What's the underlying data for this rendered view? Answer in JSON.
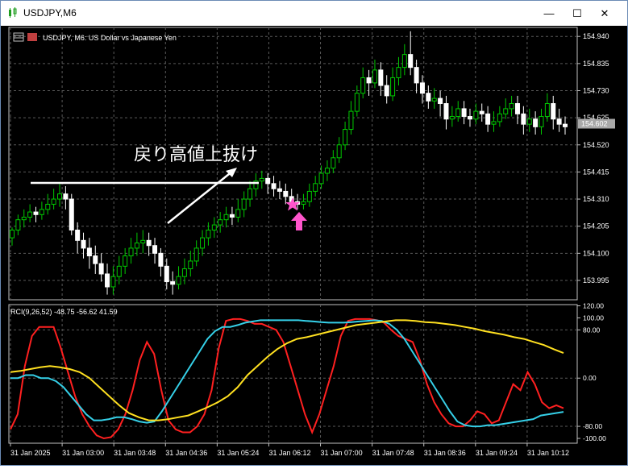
{
  "window": {
    "title": "USDJPY,M6",
    "buttons": {
      "minimize": "—",
      "maximize": "☐",
      "close": "✕"
    }
  },
  "chart_header": {
    "symbol_line": "USDJPY, M6:  US Dollar vs Japanese Yen",
    "indicator_line": "RCI(9,26,52) -48.75 -56.62 41.59"
  },
  "annotation": {
    "text": "戻り高値上抜け",
    "star_color": "#ff55cc",
    "arrow_color": "#ff55cc"
  },
  "colors": {
    "background": "#000000",
    "grid": "#5a5a5a",
    "bull": "#00c800",
    "bear": "#ffffff",
    "rci_fast": "#ff2020",
    "rci_mid": "#35d0e8",
    "rci_slow": "#ffe020",
    "axis_text": "#ffffff",
    "current_price_tag": "#a9a9a9"
  },
  "chart_data": {
    "type": "candlestick",
    "price_axis": {
      "ticks": [
        "154.940",
        "154.835",
        "154.730",
        "154.625",
        "154.520",
        "154.415",
        "154.310",
        "154.205",
        "154.100",
        "153.995"
      ],
      "tick_values": [
        154.94,
        154.835,
        154.73,
        154.625,
        154.52,
        154.415,
        154.31,
        154.205,
        154.1,
        153.995
      ],
      "range": [
        153.92,
        154.975
      ],
      "current_price": "154.602"
    },
    "time_axis": [
      "31 Jan 2025",
      "31 Jan 03:00",
      "31 Jan 03:48",
      "31 Jan 04:36",
      "31 Jan 05:24",
      "31 Jan 06:12",
      "31 Jan 07:00",
      "31 Jan 07:48",
      "31 Jan 08:36",
      "31 Jan 09:24",
      "31 Jan 10:12"
    ],
    "candles": [
      [
        154.16,
        154.19,
        154.13,
        154.2
      ],
      [
        154.19,
        154.23,
        154.17,
        154.25
      ],
      [
        154.23,
        154.24,
        154.2,
        154.27
      ],
      [
        154.24,
        154.26,
        154.22,
        154.29
      ],
      [
        154.26,
        154.25,
        154.22,
        154.28
      ],
      [
        154.25,
        154.27,
        154.23,
        154.3
      ],
      [
        154.27,
        154.29,
        154.25,
        154.33
      ],
      [
        154.29,
        154.31,
        154.27,
        154.35
      ],
      [
        154.31,
        154.33,
        154.28,
        154.37
      ],
      [
        154.33,
        154.31,
        154.27,
        154.36
      ],
      [
        154.31,
        154.19,
        154.17,
        154.33
      ],
      [
        154.19,
        154.15,
        154.1,
        154.22
      ],
      [
        154.15,
        154.12,
        154.08,
        154.18
      ],
      [
        154.12,
        154.09,
        154.04,
        154.16
      ],
      [
        154.09,
        154.06,
        154.02,
        154.13
      ],
      [
        154.06,
        154.02,
        153.99,
        154.1
      ],
      [
        154.02,
        153.97,
        153.94,
        154.06
      ],
      [
        153.97,
        154.01,
        153.94,
        154.05
      ],
      [
        154.01,
        154.05,
        153.98,
        154.09
      ],
      [
        154.05,
        154.09,
        154.02,
        154.12
      ],
      [
        154.09,
        154.12,
        154.06,
        154.16
      ],
      [
        154.12,
        154.14,
        154.09,
        154.18
      ],
      [
        154.14,
        154.15,
        154.1,
        154.19
      ],
      [
        154.15,
        154.13,
        154.09,
        154.18
      ],
      [
        154.13,
        154.1,
        154.06,
        154.16
      ],
      [
        154.1,
        154.05,
        154.01,
        154.12
      ],
      [
        154.05,
        153.99,
        153.96,
        154.08
      ],
      [
        153.99,
        153.98,
        153.94,
        154.03
      ],
      [
        153.98,
        154.01,
        153.96,
        154.05
      ],
      [
        154.01,
        154.04,
        153.98,
        154.08
      ],
      [
        154.04,
        154.07,
        154.01,
        154.11
      ],
      [
        154.07,
        154.12,
        154.05,
        154.15
      ],
      [
        154.12,
        154.16,
        154.09,
        154.19
      ],
      [
        154.16,
        154.19,
        154.13,
        154.22
      ],
      [
        154.19,
        154.21,
        154.16,
        154.24
      ],
      [
        154.21,
        154.23,
        154.18,
        154.26
      ],
      [
        154.23,
        154.25,
        154.2,
        154.28
      ],
      [
        154.25,
        154.24,
        154.21,
        154.28
      ],
      [
        154.24,
        154.27,
        154.22,
        154.31
      ],
      [
        154.27,
        154.31,
        154.24,
        154.34
      ],
      [
        154.31,
        154.35,
        154.28,
        154.38
      ],
      [
        154.35,
        154.38,
        154.32,
        154.41
      ],
      [
        154.38,
        154.39,
        154.35,
        154.42
      ],
      [
        154.39,
        154.37,
        154.33,
        154.41
      ],
      [
        154.37,
        154.35,
        154.32,
        154.4
      ],
      [
        154.35,
        154.34,
        154.31,
        154.38
      ],
      [
        154.34,
        154.32,
        154.29,
        154.37
      ],
      [
        154.32,
        154.3,
        154.28,
        154.35
      ],
      [
        154.3,
        154.29,
        154.27,
        154.33
      ],
      [
        154.29,
        154.3,
        154.27,
        154.33
      ],
      [
        154.3,
        154.34,
        154.28,
        154.37
      ],
      [
        154.34,
        154.37,
        154.32,
        154.4
      ],
      [
        154.37,
        154.41,
        154.35,
        154.44
      ],
      [
        154.41,
        154.43,
        154.38,
        154.46
      ],
      [
        154.43,
        154.47,
        154.41,
        154.5
      ],
      [
        154.47,
        154.52,
        154.45,
        154.55
      ],
      [
        154.52,
        154.58,
        154.5,
        154.61
      ],
      [
        154.58,
        154.65,
        154.56,
        154.69
      ],
      [
        154.65,
        154.72,
        154.63,
        154.75
      ],
      [
        154.72,
        154.78,
        154.7,
        154.82
      ],
      [
        154.78,
        154.76,
        154.71,
        154.81
      ],
      [
        154.76,
        154.81,
        154.74,
        154.85
      ],
      [
        154.81,
        154.75,
        154.71,
        154.84
      ],
      [
        154.75,
        154.71,
        154.68,
        154.79
      ],
      [
        154.71,
        154.78,
        154.69,
        154.82
      ],
      [
        154.78,
        154.82,
        154.75,
        154.86
      ],
      [
        154.82,
        154.87,
        154.79,
        154.91
      ],
      [
        154.87,
        154.82,
        154.79,
        154.96
      ],
      [
        154.82,
        154.76,
        154.72,
        154.85
      ],
      [
        154.76,
        154.72,
        154.68,
        154.79
      ],
      [
        154.72,
        154.69,
        154.66,
        154.75
      ],
      [
        154.69,
        154.7,
        154.66,
        154.74
      ],
      [
        154.7,
        154.68,
        154.63,
        154.73
      ],
      [
        154.68,
        154.62,
        154.58,
        154.71
      ],
      [
        154.62,
        154.63,
        154.59,
        154.67
      ],
      [
        154.63,
        154.66,
        154.61,
        154.69
      ],
      [
        154.66,
        154.63,
        154.6,
        154.69
      ],
      [
        154.63,
        154.62,
        154.59,
        154.66
      ],
      [
        154.62,
        154.65,
        154.6,
        154.68
      ],
      [
        154.65,
        154.64,
        154.61,
        154.68
      ],
      [
        154.64,
        154.6,
        154.57,
        154.67
      ],
      [
        154.6,
        154.61,
        154.57,
        154.65
      ],
      [
        154.61,
        154.64,
        154.59,
        154.67
      ],
      [
        154.64,
        154.66,
        154.62,
        154.7
      ],
      [
        154.66,
        154.68,
        154.63,
        154.71
      ],
      [
        154.68,
        154.64,
        154.6,
        154.71
      ],
      [
        154.64,
        154.6,
        154.56,
        154.67
      ],
      [
        154.6,
        154.62,
        154.57,
        154.66
      ],
      [
        154.62,
        154.59,
        154.56,
        154.65
      ],
      [
        154.59,
        154.63,
        154.56,
        154.66
      ],
      [
        154.63,
        154.68,
        154.61,
        154.72
      ],
      [
        154.68,
        154.62,
        154.58,
        154.71
      ],
      [
        154.62,
        154.6,
        154.57,
        154.66
      ],
      [
        154.6,
        154.59,
        154.56,
        154.63
      ]
    ],
    "rci_axis": {
      "ticks": [
        "120.00",
        "100.00",
        "80.00",
        "0.00",
        "-80.00",
        "-100.00"
      ],
      "tick_values": [
        120,
        100,
        80,
        0,
        -80,
        -100
      ],
      "range": [
        -108,
        122
      ]
    },
    "rci_series": [
      {
        "name": "RCI 9",
        "values": [
          -85,
          -60,
          20,
          70,
          85,
          85,
          85,
          50,
          10,
          -30,
          -60,
          -80,
          -95,
          -100,
          -98,
          -85,
          -60,
          -20,
          30,
          60,
          40,
          -20,
          -70,
          -85,
          -90,
          -90,
          -80,
          -60,
          -20,
          50,
          95,
          98,
          98,
          95,
          90,
          90,
          85,
          80,
          60,
          20,
          -20,
          -60,
          -90,
          -60,
          -20,
          20,
          70,
          95,
          98,
          98,
          98,
          96,
          92,
          80,
          70,
          65,
          60,
          30,
          -10,
          -40,
          -60,
          -75,
          -80,
          -80,
          -70,
          -55,
          -60,
          -75,
          -70,
          -40,
          -10,
          -20,
          10,
          -10,
          -40,
          -50,
          -45,
          -50
        ]
      },
      {
        "name": "RCI 26",
        "values": [
          0,
          0,
          5,
          5,
          0,
          0,
          -5,
          -15,
          -30,
          -45,
          -60,
          -70,
          -70,
          -68,
          -65,
          -65,
          -68,
          -72,
          -74,
          -72,
          -55,
          -35,
          -15,
          5,
          25,
          45,
          65,
          78,
          85,
          85,
          88,
          92,
          94,
          96,
          96,
          96,
          96,
          96,
          96,
          95,
          94,
          93,
          92,
          92,
          92,
          93,
          94,
          95,
          96,
          95,
          90,
          80,
          65,
          45,
          25,
          5,
          -15,
          -35,
          -55,
          -72,
          -78,
          -80,
          -80,
          -78,
          -78,
          -76,
          -74,
          -72,
          -70,
          -68,
          -62,
          -60,
          -58,
          -56
        ]
      },
      {
        "name": "RCI 52",
        "values": [
          10,
          12,
          15,
          18,
          20,
          18,
          15,
          10,
          0,
          -15,
          -30,
          -45,
          -58,
          -65,
          -70,
          -70,
          -68,
          -65,
          -62,
          -55,
          -48,
          -40,
          -30,
          -15,
          5,
          20,
          35,
          48,
          58,
          65,
          68,
          72,
          76,
          80,
          84,
          88,
          90,
          92,
          94,
          96,
          96,
          95,
          93,
          92,
          90,
          88,
          85,
          82,
          78,
          75,
          72,
          68,
          65,
          60,
          55,
          48,
          41.59
        ]
      }
    ]
  }
}
